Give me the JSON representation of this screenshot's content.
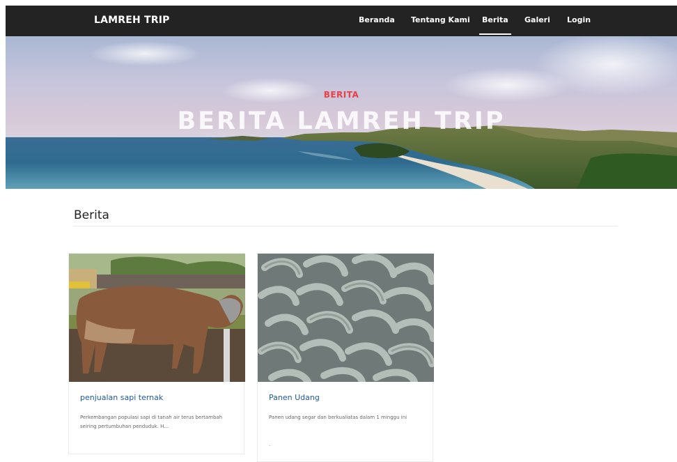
{
  "brand": "LAMREH TRIP",
  "nav": [
    "Beranda",
    "Tentang Kami",
    "Berita",
    "Galeri",
    "Login"
  ],
  "active_nav": "Berita",
  "hero": {
    "subtitle": "BERITA",
    "title": "BERITA LAMREH TRIP"
  },
  "section": {
    "title": "Berita"
  },
  "cards": [
    {
      "title": "penjualan sapi ternak",
      "text": "Perkembangan populasi sapi di tanah air terus bertambah seiring pertumbuhan penduduk. H...",
      "image": "cow-photo"
    },
    {
      "title": "Panen Udang",
      "text": "Panen udang segar dan berkualiatas dalam 1 minggu ini",
      "extra": ".",
      "image": "shrimp-photo"
    }
  ],
  "colors": {
    "navbar": "#232323",
    "accent_red": "#e8414a",
    "link_blue": "#1e5aa0"
  }
}
